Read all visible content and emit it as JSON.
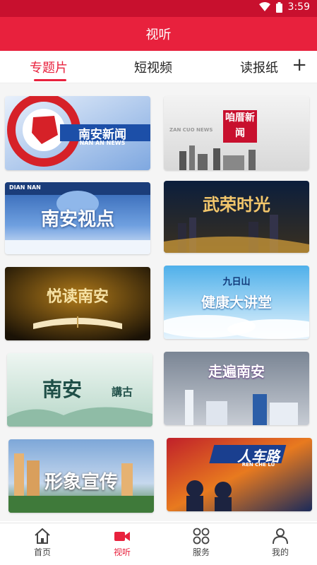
{
  "status": {
    "time": "3:59"
  },
  "header": {
    "title": "视听"
  },
  "tabs": [
    {
      "label": "专题片"
    },
    {
      "label": "短视频"
    },
    {
      "label": "读报纸"
    }
  ],
  "tab_add_symbol": "+",
  "programs": [
    {
      "title": "南安新闻",
      "subtitle": "NAN AN NEWS"
    },
    {
      "title": "咱厝新闻",
      "subtitle": "ZAN CUO NEWS"
    },
    {
      "title": "南安视点",
      "subtitle": "DIAN NAN"
    },
    {
      "title": "武荣时光",
      "subtitle": ""
    },
    {
      "title": "悦读南安",
      "subtitle": ""
    },
    {
      "title": "健康大讲堂",
      "subtitle": "九日山"
    },
    {
      "title": "南安",
      "subtitle": "講古"
    },
    {
      "title": "走遍南安",
      "subtitle": ""
    },
    {
      "title": "形象宣传",
      "subtitle": ""
    },
    {
      "title": "人车路",
      "subtitle": "REN CHE LU"
    }
  ],
  "nav": [
    {
      "label": "首页",
      "icon": "home-icon"
    },
    {
      "label": "视听",
      "icon": "video-camera-icon"
    },
    {
      "label": "服务",
      "icon": "grid-circles-icon"
    },
    {
      "label": "我的",
      "icon": "user-icon"
    }
  ],
  "colors": {
    "brand_red": "#e8213d",
    "status_red": "#c8102e"
  }
}
